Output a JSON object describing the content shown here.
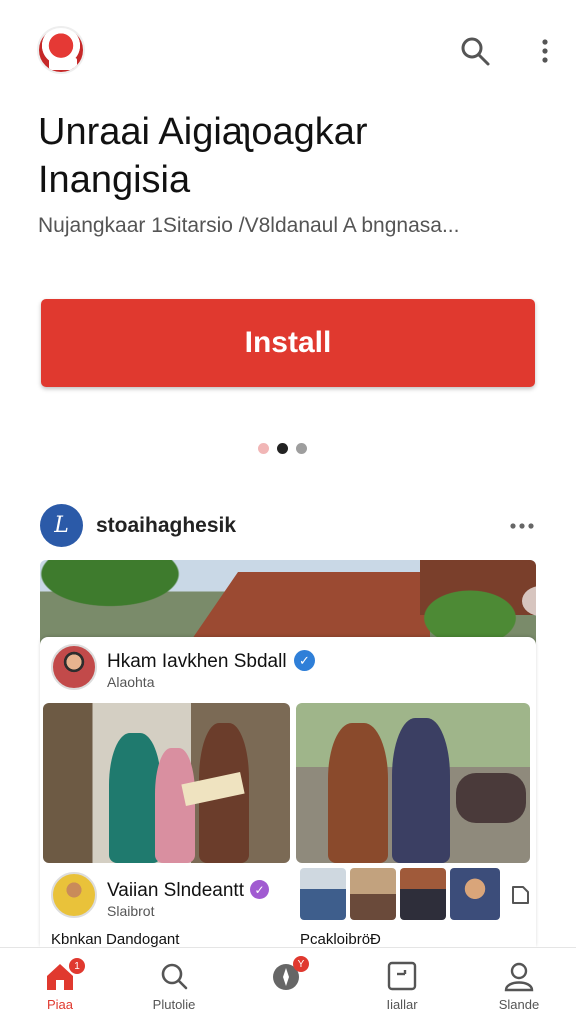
{
  "header": {
    "logo_icon": "app-logo-icon",
    "search_icon": "search-icon",
    "more_icon": "more-vertical-icon"
  },
  "app": {
    "title_line1": "Unraai Aigiaʅoagkar",
    "title_line2": "Inangisia",
    "subtitle": "Nujangkaar 1Sitarsio /V8ldanaul A bngnasa...",
    "install_label": "Install"
  },
  "carousel": {
    "active_index": 1,
    "count": 3,
    "colors": [
      "#f1b6b6",
      "#222222",
      "#9e9e9e"
    ]
  },
  "post": {
    "avatar_letter": "L",
    "account_name": "stoaihaghesik",
    "more_icon": "more-horizontal-icon"
  },
  "card": {
    "author_name": "Hkam Iavkhen Sbdall",
    "author_handle": "Alaohta",
    "verified_icon": "verified-check-icon",
    "footer_author": "Vaiian Slndeantt",
    "footer_handle": "Slaibrot",
    "caption_left": "Kbnkan Dandogant",
    "caption_right": "PcakloibröĐ"
  },
  "nav": {
    "items": [
      {
        "label": "Piaa",
        "icon": "home-icon",
        "active": true,
        "badge": "1"
      },
      {
        "label": "Plutolie",
        "icon": "search-icon",
        "active": false,
        "badge": ""
      },
      {
        "label": "",
        "icon": "compass-icon",
        "active": false,
        "badge": "Y"
      },
      {
        "label": "Iiallar",
        "icon": "library-icon",
        "active": false,
        "badge": ""
      },
      {
        "label": "Slande",
        "icon": "profile-icon",
        "active": false,
        "badge": ""
      }
    ]
  },
  "colors": {
    "accent": "#e0392f",
    "verified_blue": "#2f7fd8",
    "verified_purple": "#a15bd1",
    "avatar_blue": "#2b5aa8"
  }
}
